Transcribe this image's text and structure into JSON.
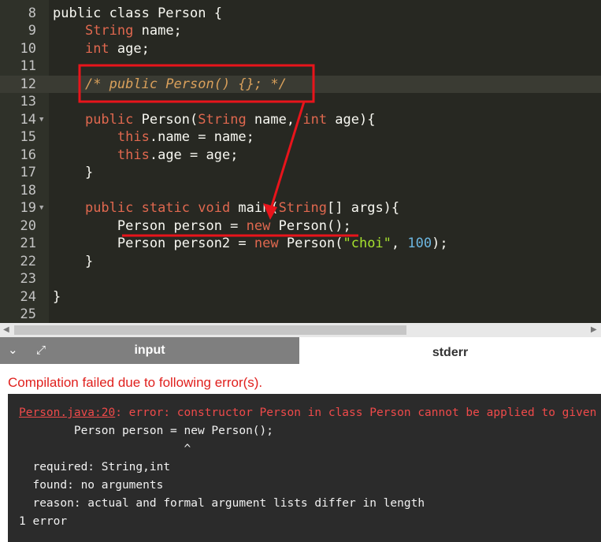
{
  "editor": {
    "lines": [
      {
        "num": "8",
        "fold": false,
        "tokens": [
          {
            "t": "public class ",
            "c": "plain"
          },
          {
            "t": "Person {",
            "c": "plain"
          }
        ]
      },
      {
        "num": "9",
        "fold": false,
        "tokens": [
          {
            "t": "    ",
            "c": "plain"
          },
          {
            "t": "String",
            "c": "ty"
          },
          {
            "t": " name;",
            "c": "plain"
          }
        ]
      },
      {
        "num": "10",
        "fold": false,
        "tokens": [
          {
            "t": "    ",
            "c": "plain"
          },
          {
            "t": "int",
            "c": "ty"
          },
          {
            "t": " age;",
            "c": "plain"
          }
        ]
      },
      {
        "num": "11",
        "fold": false,
        "tokens": []
      },
      {
        "num": "12",
        "fold": false,
        "active": true,
        "tokens": [
          {
            "t": "    ",
            "c": "plain"
          },
          {
            "t": "/* public Person() {}; */",
            "c": "cm"
          }
        ]
      },
      {
        "num": "13",
        "fold": false,
        "tokens": []
      },
      {
        "num": "14",
        "fold": true,
        "tokens": [
          {
            "t": "    ",
            "c": "plain"
          },
          {
            "t": "public",
            "c": "kw"
          },
          {
            "t": " Person(",
            "c": "plain"
          },
          {
            "t": "String",
            "c": "ty"
          },
          {
            "t": " name, ",
            "c": "plain"
          },
          {
            "t": "int",
            "c": "ty"
          },
          {
            "t": " age){",
            "c": "plain"
          }
        ]
      },
      {
        "num": "15",
        "fold": false,
        "tokens": [
          {
            "t": "        ",
            "c": "plain"
          },
          {
            "t": "this",
            "c": "kw"
          },
          {
            "t": ".name = name;",
            "c": "plain"
          }
        ]
      },
      {
        "num": "16",
        "fold": false,
        "tokens": [
          {
            "t": "        ",
            "c": "plain"
          },
          {
            "t": "this",
            "c": "kw"
          },
          {
            "t": ".age = age;",
            "c": "plain"
          }
        ]
      },
      {
        "num": "17",
        "fold": false,
        "tokens": [
          {
            "t": "    }",
            "c": "plain"
          }
        ]
      },
      {
        "num": "18",
        "fold": false,
        "tokens": []
      },
      {
        "num": "19",
        "fold": true,
        "tokens": [
          {
            "t": "    ",
            "c": "plain"
          },
          {
            "t": "public static void",
            "c": "kw"
          },
          {
            "t": " main(",
            "c": "plain"
          },
          {
            "t": "String",
            "c": "ty"
          },
          {
            "t": "[] args){",
            "c": "plain"
          }
        ]
      },
      {
        "num": "20",
        "fold": false,
        "tokens": [
          {
            "t": "        Person person = ",
            "c": "plain"
          },
          {
            "t": "new",
            "c": "kw"
          },
          {
            "t": " Person();",
            "c": "plain"
          }
        ]
      },
      {
        "num": "21",
        "fold": false,
        "tokens": [
          {
            "t": "        Person person2 = ",
            "c": "plain"
          },
          {
            "t": "new",
            "c": "kw"
          },
          {
            "t": " Person(",
            "c": "plain"
          },
          {
            "t": "\"choi\"",
            "c": "st"
          },
          {
            "t": ", ",
            "c": "plain"
          },
          {
            "t": "100",
            "c": "nm"
          },
          {
            "t": ");",
            "c": "plain"
          }
        ]
      },
      {
        "num": "22",
        "fold": false,
        "tokens": [
          {
            "t": "    }",
            "c": "plain"
          }
        ]
      },
      {
        "num": "23",
        "fold": false,
        "tokens": []
      },
      {
        "num": "24",
        "fold": false,
        "tokens": [
          {
            "t": "}",
            "c": "plain"
          }
        ]
      },
      {
        "num": "25",
        "fold": false,
        "tokens": []
      }
    ]
  },
  "tabs": {
    "input_label": "input",
    "stderr_label": "stderr"
  },
  "output": {
    "error_title": "Compilation failed due to following error(s).",
    "file_ref": "Person.java:20",
    "error_text": ": error: constructor Person in class Person cannot be applied to given types;",
    "lines": [
      "        Person person = new Person();",
      "                        ^",
      "  required: String,int",
      "  found: no arguments",
      "  reason: actual and formal argument lists differ in length",
      "1 error"
    ]
  },
  "colors": {
    "annotation": "#e8141b",
    "editor_bg": "#272822"
  }
}
